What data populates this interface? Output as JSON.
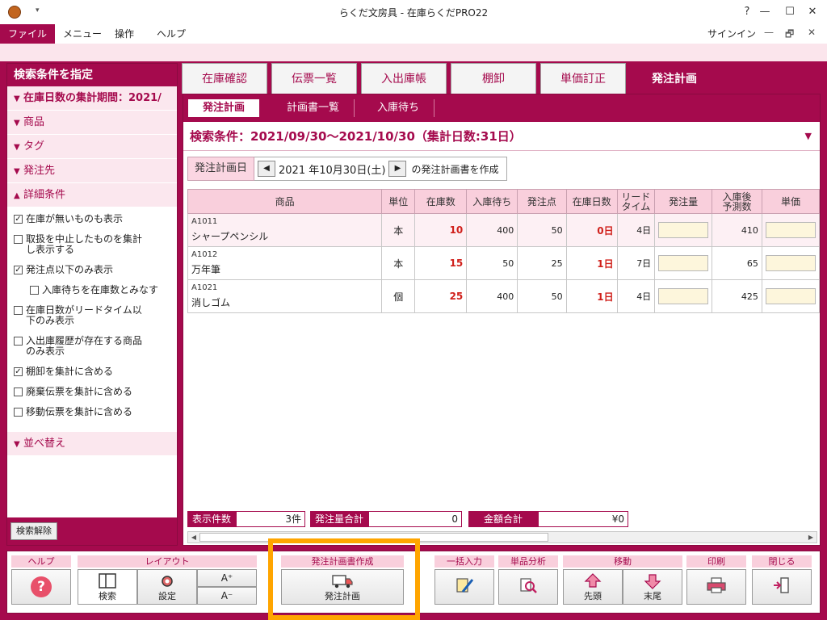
{
  "window": {
    "title": "らくだ文房具 - 在庫らくだPRO22",
    "help_button": "?",
    "minimize": "—",
    "maximize": "☐",
    "close": "✕"
  },
  "menu": {
    "items": [
      "ファイル",
      "メニュー",
      "操作",
      "ヘルプ"
    ],
    "signin": "サインイン",
    "min": "—",
    "restore": "🗗",
    "close": "✕"
  },
  "left_panel": {
    "title": "検索条件を指定",
    "sections_top": [
      {
        "label": "在庫日数の集計期間：2021/",
        "tri": "▼"
      },
      {
        "label": "商品",
        "tri": "▼"
      },
      {
        "label": "タグ",
        "tri": "▼"
      },
      {
        "label": "発注先",
        "tri": "▼"
      },
      {
        "label": "詳細条件",
        "tri": "▲"
      }
    ],
    "checkboxes": [
      {
        "label": "在庫が無いものも表示",
        "checked": "✓"
      },
      {
        "label": "取扱を中止したものを集計\nし表示する",
        "checked": ""
      },
      {
        "label": "発注点以下のみ表示",
        "checked": "✓"
      },
      {
        "label": "入庫待ちを在庫数とみなす",
        "checked": ""
      },
      {
        "label": "在庫日数がリードタイム以\n下のみ表示",
        "checked": ""
      },
      {
        "label": "入出庫履歴が存在する商品\nのみ表示",
        "checked": ""
      },
      {
        "label": "棚卸を集計に含める",
        "checked": "✓"
      },
      {
        "label": "廃棄伝票を集計に含める",
        "checked": ""
      },
      {
        "label": "移動伝票を集計に含める",
        "checked": ""
      }
    ],
    "sort_section": {
      "label": "並べ替え",
      "tri": "▼"
    },
    "clear_button": "検索解除"
  },
  "tabs": [
    "在庫確認",
    "伝票一覧",
    "入出庫帳",
    "棚卸",
    "単価訂正",
    "発注計画"
  ],
  "subtabs": [
    "発注計画",
    "計画書一覧",
    "入庫待ち"
  ],
  "search_condition": "検索条件：2021/09/30〜2021/10/30（集計日数:31日）",
  "search_arrow": "▼",
  "plan": {
    "label": "発注計画日",
    "prev": "◀",
    "date": "2021 年10月30日(土)",
    "next": "▶",
    "suffix": "の発注計画書を作成"
  },
  "table": {
    "headers": [
      "商品",
      "単位",
      "在庫数",
      "入庫待ち",
      "発注点",
      "在庫日数",
      "リード\nタイム",
      "発注量",
      "入庫後\n予測数",
      "単価"
    ],
    "rows": [
      {
        "code": "A1011",
        "name": "シャープペンシル",
        "unit": "本",
        "stock": "10",
        "waiting": "400",
        "order_point": "50",
        "days": "0日",
        "lead": "4日",
        "forecast": "410"
      },
      {
        "code": "A1012",
        "name": "万年筆",
        "unit": "本",
        "stock": "15",
        "waiting": "50",
        "order_point": "25",
        "days": "1日",
        "lead": "7日",
        "forecast": "65"
      },
      {
        "code": "A1021",
        "name": "消しゴム",
        "unit": "個",
        "stock": "25",
        "waiting": "400",
        "order_point": "50",
        "days": "1日",
        "lead": "4日",
        "forecast": "425"
      }
    ]
  },
  "summary": {
    "count_label": "表示件数",
    "count_value": "3件",
    "qty_label": "発注量合計",
    "qty_value": "0",
    "amount_label": "金額合計",
    "amount_value": "¥0"
  },
  "toolbar": {
    "help": {
      "group": "ヘルプ",
      "icon": "?"
    },
    "layout": {
      "group": "レイアウト",
      "search": "検索",
      "settings": "設定",
      "font_up": "A⁺",
      "font_down": "A⁻"
    },
    "create": {
      "group": "発注計画書作成",
      "button": "発注計画"
    },
    "bulk": {
      "group": "一括入力"
    },
    "analysis": {
      "group": "単品分析"
    },
    "move": {
      "group": "移動",
      "first": "先頭",
      "last": "末尾"
    },
    "print": {
      "group": "印刷"
    },
    "close": {
      "group": "閉じる"
    }
  }
}
